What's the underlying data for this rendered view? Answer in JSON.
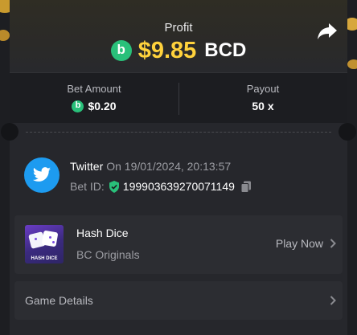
{
  "profit": {
    "label": "Profit",
    "amount": "$9.85",
    "currency": "BCD"
  },
  "stats": {
    "bet_amount_label": "Bet Amount",
    "bet_amount_value": "$0.20",
    "payout_label": "Payout",
    "payout_value": "50 x"
  },
  "bet": {
    "source_name": "Twitter",
    "date_text": "On 19/01/2024, 20:13:57",
    "bet_id_label": "Bet ID:",
    "bet_id_value": "199903639270071149"
  },
  "game": {
    "name": "Hash Dice",
    "provider": "BC Originals",
    "action_label": "Play Now",
    "thumb_label": "HASH DICE"
  },
  "details": {
    "label": "Game Details"
  },
  "colors": {
    "accent_yellow": "#ffd23c",
    "bcd_green": "#29c07a",
    "twitter_blue": "#1d9bf0"
  },
  "icons": [
    "bcd-coin-icon",
    "share-icon",
    "twitter-icon",
    "verified-shield-icon",
    "copy-icon",
    "chevron-right-icon"
  ]
}
